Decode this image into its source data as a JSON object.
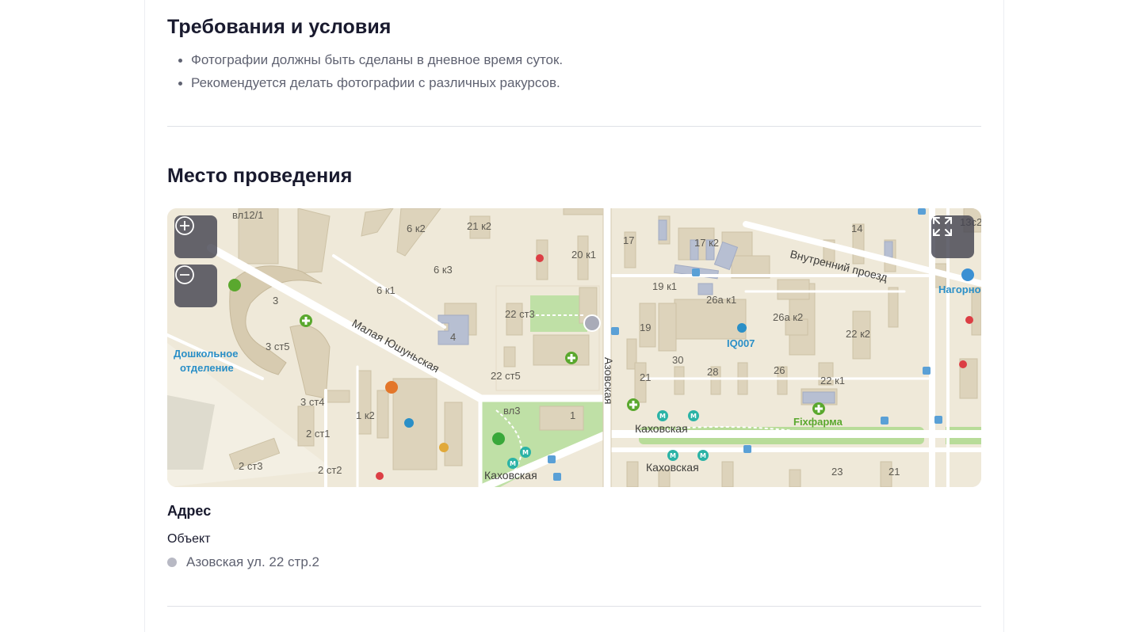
{
  "requirements": {
    "title": "Требования и условия",
    "items": [
      "Фотографии должны быть сделаны в дневное время суток.",
      "Рекомендуется делать фотографии с различных ракурсов."
    ]
  },
  "venue": {
    "title": "Место проведения",
    "map": {
      "controls": {
        "zoom_in_icon": "zoom-in-icon",
        "zoom_out_icon": "zoom-out-icon",
        "fullscreen_icon": "fullscreen-icon"
      },
      "labels": {
        "street_malaya": "Малая Юшуньская",
        "street_azovskaya": "Азовская",
        "street_vnutrenny": "Внутренний проезд",
        "metro_1": "Каховская",
        "metro_2": "Каховская",
        "metro_3": "Каховская",
        "poi_doshkolnoe_1": "Дошкольное",
        "poi_doshkolnoe_2": "отделение",
        "poi_iq": "IQ007",
        "poi_pharmacy": "Fixфарма",
        "poi_nagorn": "Нагорно",
        "b_vl12": "вл12/1",
        "b_6k2": "6 к2",
        "b_21k2": "21 к2",
        "b_20k1": "20 к1",
        "b_17": "17",
        "b_17k2": "17 к2",
        "b_14": "14",
        "b_13s2": "13с2",
        "b_6k3": "6 к3",
        "b_6k1": "6 к1",
        "b_3": "3",
        "b_19k1": "19 к1",
        "b_26ak1": "26а к1",
        "b_22s3": "22 ст3",
        "b_4": "4",
        "b_3s5": "3 ст5",
        "b_19": "19",
        "b_26ak2": "26а к2",
        "b_22k2": "22 к2",
        "b_30": "30",
        "b_28": "28",
        "b_26": "26",
        "b_22k1": "22 к1",
        "b_22s5": "22 ст5",
        "b_21": "21",
        "b_3s4": "3 ст4",
        "b_1k2": "1 к2",
        "b_vl3": "вл3",
        "b_1": "1",
        "b_2s1": "2 ст1",
        "b_2s3": "2 ст3",
        "b_2s2": "2 ст2",
        "b_23": "23",
        "b_21b": "21"
      }
    },
    "address": {
      "title": "Адрес",
      "object_label": "Объект",
      "value": "Азовская ул. 22 стр.2"
    }
  },
  "colors": {
    "map_bg": "#efe9d9",
    "park": "#bfe0a6",
    "road": "#ffffff",
    "metro": "#2bb3a6",
    "poi_blue": "#2a8fc7",
    "pharmacy_green": "#5aa82e"
  }
}
